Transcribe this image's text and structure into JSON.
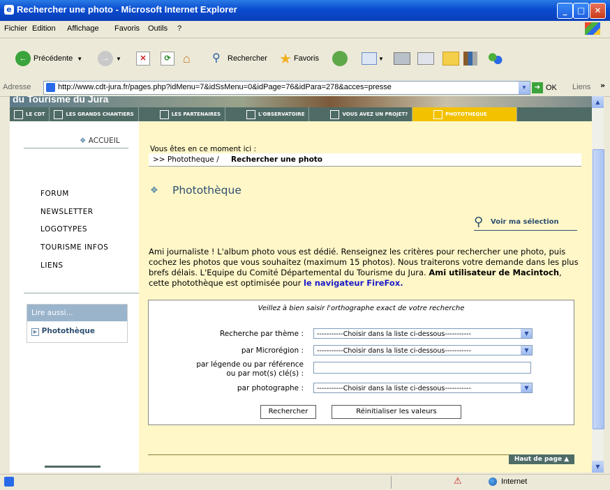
{
  "window": {
    "title": "Rechercher une photo - Microsoft Internet Explorer"
  },
  "menubar": [
    "Fichier",
    "Edition",
    "Affichage",
    "Favoris",
    "Outils",
    "?"
  ],
  "toolbar": {
    "back": "Précédente",
    "search": "Rechercher",
    "favorites": "Favoris"
  },
  "address": {
    "label": "Adresse",
    "url": "http://www.cdt-jura.fr/pages.php?idMenu=7&idSsMenu=0&idPage=76&idPara=278&acces=presse",
    "go": "OK",
    "links": "Liens"
  },
  "status": {
    "zone": "Internet"
  },
  "site": {
    "banner_text": "du Tourisme du Jura",
    "nav": [
      "LE CDT",
      "LES GRANDS CHANTIERS",
      "LES PARTENAIRES",
      "L'OBSERVATOIRE",
      "VOUS AVEZ UN PROJET?",
      "PHOTOTHEQUE"
    ],
    "home": "ACCUEIL",
    "left_menu": [
      "FORUM",
      "NEWSLETTER",
      "LOGOTYPES",
      "TOURISME INFOS",
      "LIENS"
    ],
    "see_also": {
      "title": "Lire aussi...",
      "item": "Photothèque"
    },
    "breadcrumb": {
      "intro": "Vous êtes en ce moment ici :",
      "prefix": ">> Phototheque / ",
      "current": "Rechercher une photo"
    },
    "heading": "Photothèque",
    "selection_link": "Voir ma sélection",
    "intro": {
      "p1": "Ami journaliste ! L'album photo vous est dédié. Renseignez les critères pour rechercher une photo, puis cochez les photos que vous souhaitez (maximum 15 photos). Nous traiterons votre demande dans les plus brefs délais. L'Equipe du Comité Départemental du Tourisme du Jura. ",
      "bold": "Ami utilisateur de Macintoch",
      "p2": ", cette photothèque est optimisée pour ",
      "link": "le navigateur FireFox."
    },
    "form": {
      "notice": "Veillez à bien saisir l'orthographe exact de votre recherche",
      "theme_label": "Recherche par thème :",
      "region_label": "par Microrégion :",
      "keyword_label_1": "par légende ou par référence",
      "keyword_label_2": "ou par mot(s) clé(s) :",
      "photographer_label": "par photographe :",
      "select_value": "-----------Choisir dans la liste ci-dessous-----------",
      "keyword_value": "",
      "search_button": "Rechercher",
      "reset_button": "Réinitialiser les valeurs"
    },
    "top_link": "Haut de page"
  }
}
